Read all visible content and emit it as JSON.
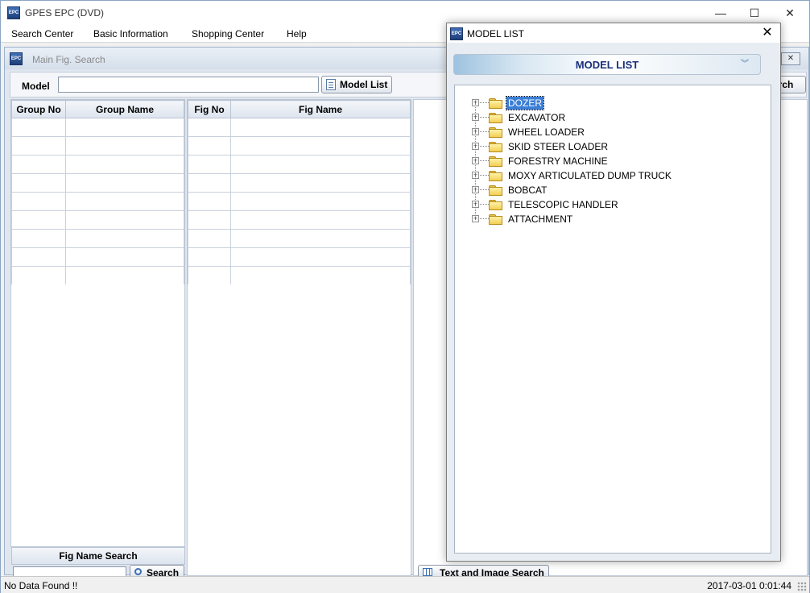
{
  "app": {
    "icon_text": "EPC",
    "title": "GPES EPC (DVD)",
    "window_controls": {
      "minimize": "—",
      "maximize": "☐",
      "close": "✕"
    }
  },
  "menu": [
    "Search Center",
    "Basic Information",
    "Shopping Center",
    "Help"
  ],
  "child_window": {
    "icon_text": "EPC",
    "title": "Main Fig. Search",
    "close": "✕",
    "model_label": "Model",
    "model_value": "",
    "model_list_button": "Model List",
    "search_button_partial": "arch",
    "group_grid": {
      "headers": [
        "Group No",
        "Group Name"
      ],
      "row_count": 9
    },
    "fig_grid": {
      "headers": [
        "Fig No",
        "Fig Name"
      ],
      "row_count": 9
    },
    "fig_name_search": {
      "header": "Fig Name Search",
      "value": "",
      "button": "Search"
    },
    "text_image_search_button": "Text and Image Search"
  },
  "status": {
    "left": "No Data Found !!",
    "right": "2017-03-01 0:01:44"
  },
  "dialog": {
    "icon_text": "EPC",
    "title": "MODEL LIST",
    "close": "✕",
    "banner": "MODEL LIST",
    "banner_chevron": "︾",
    "expander": "+",
    "tree": [
      {
        "label": "DOZER",
        "selected": true
      },
      {
        "label": "EXCAVATOR",
        "selected": false
      },
      {
        "label": "WHEEL LOADER",
        "selected": false
      },
      {
        "label": "SKID STEER LOADER",
        "selected": false
      },
      {
        "label": "FORESTRY MACHINE",
        "selected": false
      },
      {
        "label": "MOXY ARTICULATED DUMP TRUCK",
        "selected": false
      },
      {
        "label": "BOBCAT",
        "selected": false
      },
      {
        "label": "TELESCOPIC HANDLER",
        "selected": false
      },
      {
        "label": "ATTACHMENT",
        "selected": false
      }
    ]
  }
}
